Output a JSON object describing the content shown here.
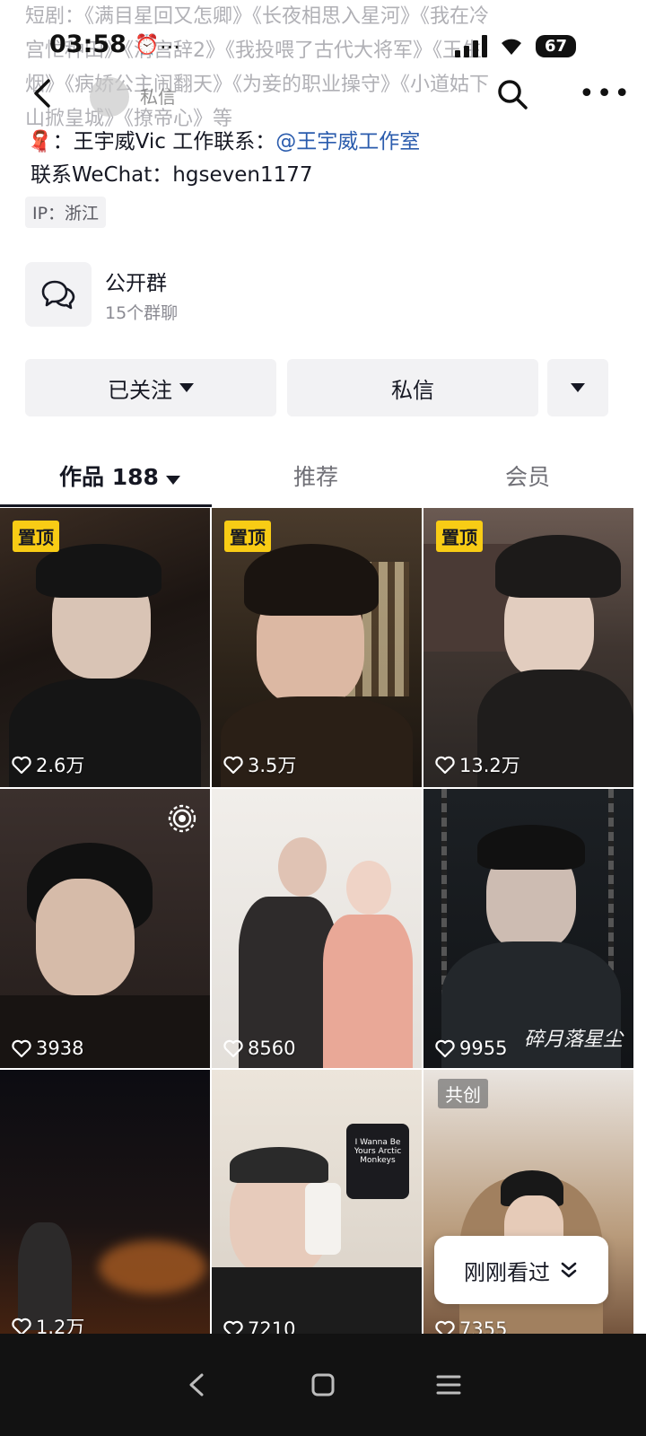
{
  "status_bar": {
    "time": "03:58",
    "extra": "...",
    "battery": "67"
  },
  "header": {
    "dm_label": "私信"
  },
  "bio": {
    "lines": [
      "短剧：《满目星回又怎卿》《长夜相思入星河》《我在冷",
      "宫忙种田》《清宫辞2》《我投喂了古代大将军》《玉生",
      "烟》《病娇公主闹翻天》《为妾的职业操守》《小道姑下",
      "山掀皇城》《撩帝心》等"
    ],
    "contact_prefix": "：王宇威Vic  工作联系：",
    "contact_link": "@王宇威工作室",
    "wechat": "联系WeChat：hgseven1177",
    "ip": "IP：浙江"
  },
  "group": {
    "title": "公开群",
    "subtitle": "15个群聊"
  },
  "actions": {
    "follow": "已关注",
    "message": "私信"
  },
  "tabs": {
    "works": "作品 188",
    "recommend": "推荐",
    "vip": "会员"
  },
  "grid": {
    "pin_label": "置顶",
    "collab_label": "共创",
    "calligraphy": "碎月落星尘",
    "sticker_text": "I Wanna Be Yours Arctic Monkeys",
    "items": [
      {
        "likes": "2.6万"
      },
      {
        "likes": "3.5万"
      },
      {
        "likes": "13.2万"
      },
      {
        "likes": "3938"
      },
      {
        "likes": "8560"
      },
      {
        "likes": "9955"
      },
      {
        "likes": "1.2万"
      },
      {
        "likes": "7210"
      },
      {
        "likes": "7355"
      }
    ]
  },
  "recent_pill": {
    "label": "刚刚看过"
  },
  "colors": {
    "pin": "#f8cc15",
    "link": "#2b5cad",
    "button_bg": "#f2f2f4",
    "navbar": "#121212"
  }
}
